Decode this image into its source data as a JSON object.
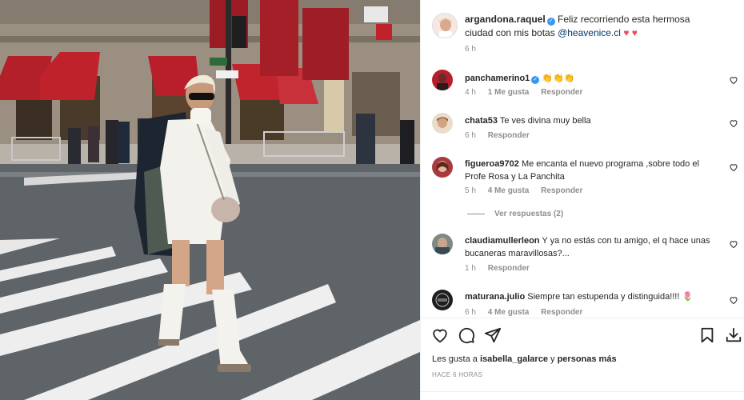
{
  "post": {
    "author": "argandona.raquel",
    "verified_mark": "✓",
    "caption": "Feliz recorriendo esta hermosa ciudad con mis botas",
    "caption_mention": "@heavenice.cl",
    "caption_hearts": "♥ ♥",
    "time": "6 h"
  },
  "comments": [
    {
      "user": "panchamerino1",
      "verified": true,
      "text": "👏👏👏",
      "time": "4 h",
      "likes": "1 Me gusta",
      "reply": "Responder"
    },
    {
      "user": "chata53",
      "verified": false,
      "text": "Te ves divina muy bella",
      "time": "6 h",
      "likes": "",
      "reply": "Responder"
    },
    {
      "user": "figueroa9702",
      "verified": false,
      "text": "Me encanta el nuevo programa ,sobre todo el Profe Rosa y La Panchita",
      "time": "5 h",
      "likes": "4 Me gusta",
      "reply": "Responder"
    },
    {
      "user": "claudiamullerleon",
      "verified": false,
      "text": "Y ya no estás con tu amigo, el q hace unas bucaneras maravillosas?...",
      "time": "1 h",
      "likes": "",
      "reply": "Responder"
    },
    {
      "user": "maturana.julio",
      "verified": false,
      "text": "Siempre tan estupenda y distinguida!!!! 🌷",
      "time": "6 h",
      "likes": "4 Me gusta",
      "reply": "Responder"
    }
  ],
  "view_replies": "Ver respuestas (2)",
  "likes_line": {
    "prefix": "Les gusta a",
    "user": "isabella_galarce",
    "middle": "y",
    "suffix": "personas más"
  },
  "timestamp": "HACE 6 HORAS",
  "icons": {
    "like": "heart-icon",
    "comment": "comment-icon",
    "share": "share-icon",
    "save": "bookmark-icon",
    "download": "download-icon"
  },
  "colors": {
    "verified": "#3897f0",
    "heart": "#ed4956",
    "mention": "#00376b",
    "muted": "#8e8e8e"
  }
}
